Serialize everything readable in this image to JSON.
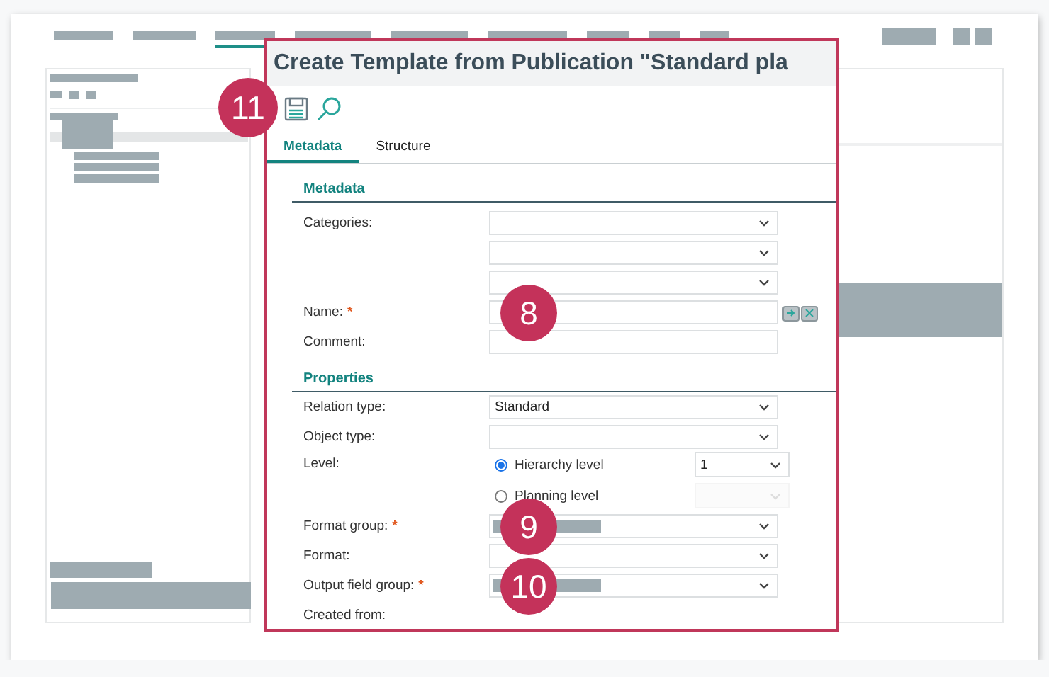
{
  "nav": {
    "items": [
      {
        "selected": false
      },
      {
        "selected": false
      },
      {
        "selected": true
      },
      {
        "selected": false
      },
      {
        "selected": false
      },
      {
        "selected": false
      },
      {
        "selected": false
      },
      {
        "selected": false
      },
      {
        "selected": false
      }
    ]
  },
  "dialog": {
    "title": "Create Template from Publication \"Standard pla",
    "toolbar": {
      "callout": "11",
      "tools": [
        {
          "kind": "save"
        },
        {
          "kind": "search"
        }
      ]
    },
    "tabs": [
      {
        "label": "Metadata",
        "selected": true
      },
      {
        "label": "Structure",
        "selected": false
      }
    ],
    "sections": [
      {
        "title": "Metadata",
        "rows": [
          {
            "kind": "dropdown",
            "label": "Categories:"
          },
          {
            "kind": "dropdown"
          },
          {
            "kind": "dropdown"
          },
          {
            "kind": "text",
            "label": "Name:",
            "required_mark": "*",
            "callout": "8",
            "actions": [
              {
                "kind": "insert"
              },
              {
                "kind": "clear"
              }
            ]
          },
          {
            "kind": "text",
            "label": "Comment:"
          }
        ]
      },
      {
        "title": "Properties",
        "rows": [
          {
            "kind": "dropdown",
            "label": "Relation type:",
            "value": "Standard"
          },
          {
            "kind": "dropdown",
            "label": "Object type:"
          },
          {
            "kind": "radio",
            "label": "Level:",
            "options": [
              {
                "label": "Hierarchy level",
                "selected": true,
                "value": "1",
                "disabled": false
              },
              {
                "label": "Planning level",
                "selected": false,
                "disabled": true
              }
            ]
          },
          {
            "kind": "dropdown",
            "label": "Format group:",
            "required_mark": "*",
            "redacted": true,
            "callout": "9"
          },
          {
            "kind": "dropdown",
            "label": "Format:"
          },
          {
            "kind": "dropdown",
            "label": "Output field group:",
            "required_mark": "*",
            "redacted": true,
            "callout": "10"
          },
          {
            "kind": "label",
            "label": "Created from:"
          }
        ]
      }
    ]
  }
}
